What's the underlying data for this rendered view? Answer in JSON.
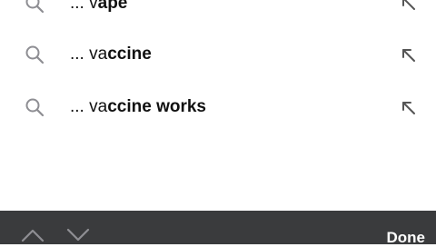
{
  "suggestions": [
    {
      "prefix": "...",
      "typed": "v",
      "completion": "ape",
      "icon": "search-icon",
      "action_icon": "fill-in-arrow-icon"
    },
    {
      "prefix": "...",
      "typed": "va",
      "completion": "ccine",
      "icon": "search-icon",
      "action_icon": "fill-in-arrow-icon"
    },
    {
      "prefix": "...",
      "typed": "va",
      "completion": "ccine works",
      "icon": "search-icon",
      "action_icon": "fill-in-arrow-icon"
    }
  ],
  "toolbar": {
    "prev_icon": "chevron-up-icon",
    "next_icon": "chevron-down-icon",
    "done_label": "Done",
    "background": "#3a3b3d"
  }
}
